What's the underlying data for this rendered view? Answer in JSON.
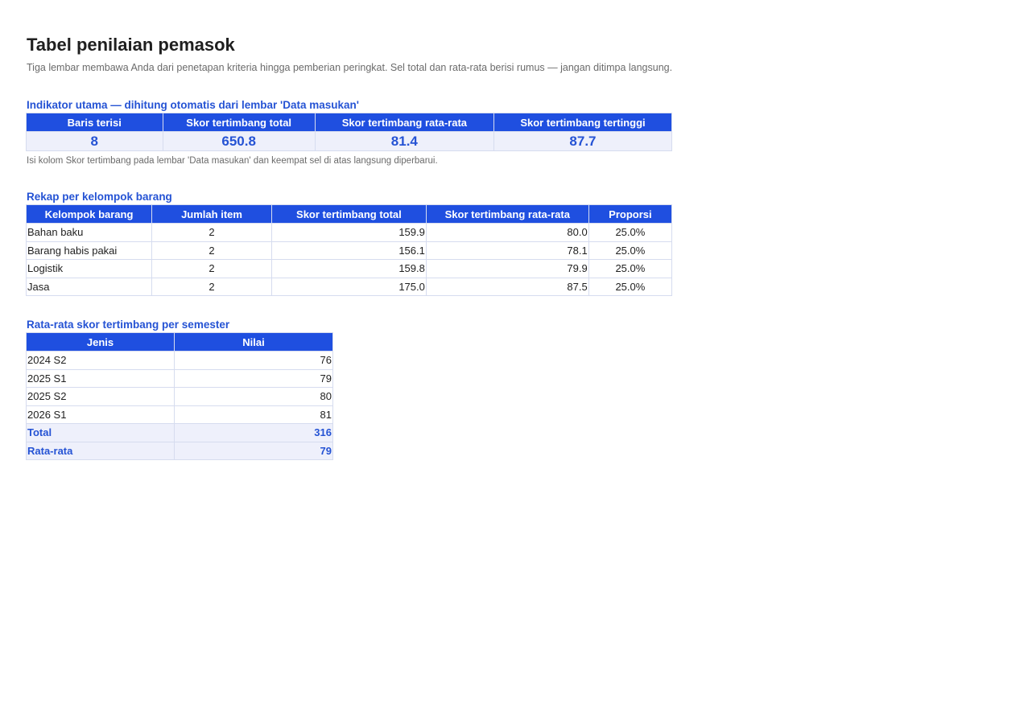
{
  "page": {
    "title": "Tabel penilaian pemasok",
    "subtitle": "Tiga lembar membawa Anda dari penetapan kriteria hingga pemberian peringkat. Sel total dan rata-rata berisi rumus — jangan ditimpa langsung."
  },
  "kpi": {
    "heading": "Indikator utama — dihitung otomatis dari lembar 'Data masukan'",
    "headers": [
      "Baris terisi",
      "Skor tertimbang total",
      "Skor tertimbang rata-rata",
      "Skor tertimbang tertinggi"
    ],
    "values": [
      "8",
      "650.8",
      "81.4",
      "87.7"
    ],
    "note": "Isi kolom Skor tertimbang pada lembar 'Data masukan' dan keempat sel di atas langsung diperbarui."
  },
  "groups": {
    "heading": "Rekap per kelompok barang",
    "headers": [
      "Kelompok barang",
      "Jumlah item",
      "Skor tertimbang total",
      "Skor tertimbang rata-rata",
      "Proporsi"
    ],
    "rows": [
      [
        "Bahan baku",
        "2",
        "159.9",
        "80.0",
        "25.0%"
      ],
      [
        "Barang habis pakai",
        "2",
        "156.1",
        "78.1",
        "25.0%"
      ],
      [
        "Logistik",
        "2",
        "159.8",
        "79.9",
        "25.0%"
      ],
      [
        "Jasa",
        "2",
        "175.0",
        "87.5",
        "25.0%"
      ]
    ]
  },
  "semester": {
    "heading": "Rata-rata skor tertimbang per semester",
    "headers": [
      "Jenis",
      "Nilai"
    ],
    "rows": [
      [
        "2024 S2",
        "76"
      ],
      [
        "2025 S1",
        "79"
      ],
      [
        "2025 S2",
        "80"
      ],
      [
        "2026 S1",
        "81"
      ]
    ],
    "total": [
      "Total",
      "316"
    ],
    "average": [
      "Rata-rata",
      "79"
    ]
  },
  "colors": {
    "accent": "#2553d4",
    "header_bg": "#1f4fe0",
    "summary_bg": "#eef0fb",
    "border": "#d6dcef"
  }
}
